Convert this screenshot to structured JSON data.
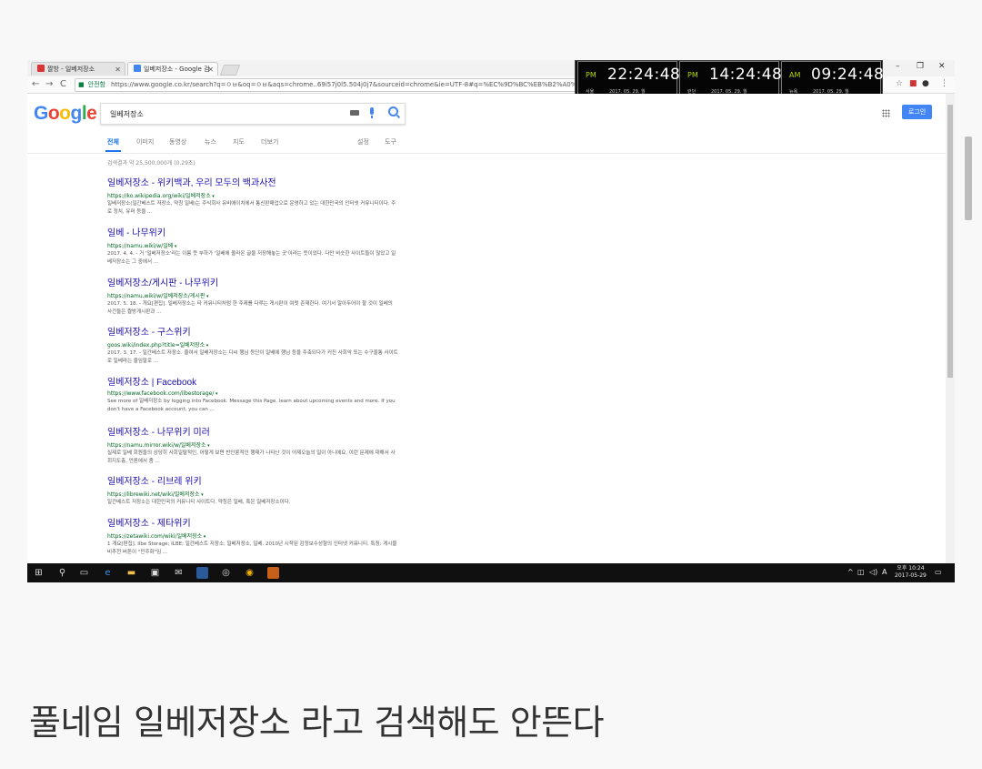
{
  "browser": {
    "tabs": [
      {
        "label": "짤방 - 일베저장소",
        "active": false,
        "favicon_color": "#d33"
      },
      {
        "label": "일베저장소 - Google 검",
        "active": true,
        "favicon_color": "#4285f4"
      }
    ],
    "window_controls": [
      "–",
      "❐",
      "✕"
    ],
    "nav": {
      "back": "←",
      "forward": "→",
      "reload": "C"
    },
    "address": {
      "secure_label": "안전함",
      "url": "https://www.google.co.kr/search?q=ㅇㅂ&oq=ㅇㅂ&aqs=chrome..69i57j0l5.504j0j7&sourceid=chrome&ie=UTF-8#q=%EC%9D%BC%EB%B2%A0%EC%A0%80%EC%9E%A5%EC%86%8C"
    }
  },
  "clocks": [
    {
      "ampm": "PM",
      "time": "22:24:48",
      "city": "서울",
      "date": "2017. 05. 29. 월"
    },
    {
      "ampm": "PM",
      "time": "14:24:48",
      "city": "런던",
      "date": "2017. 05. 29. 월"
    },
    {
      "ampm": "AM",
      "time": "09:24:48",
      "city": "뉴욕",
      "date": "2017. 05. 29. 월"
    }
  ],
  "google": {
    "logo_letters": [
      "G",
      "o",
      "o",
      "g",
      "l",
      "e"
    ],
    "query": "일베저장소",
    "login_label": "로그인",
    "tabs": [
      "전체",
      "이미지",
      "동영상",
      "뉴스",
      "지도",
      "더보기"
    ],
    "right_tabs": [
      "설정",
      "도구"
    ],
    "stats": "검색결과 약 25,500,000개 (0.29초)",
    "results": [
      {
        "title": "일베저장소 - 위키백과, 우리 모두의 백과사전",
        "url": "https://ko.wikipedia.org/wiki/일베저장소",
        "snippet": "일베저장소(일간베스트 저장소, 약칭 일베)는 주식회사 유비에이치에서 통신판매업으로 운영하고 있는 대한민국의 인터넷 커뮤니티이다. 주로 정치, 유머 등을 ..."
      },
      {
        "title": "일베 - 나무위키",
        "url": "https://namu.wiki/w/일베",
        "snippet": "2017. 4. 4. - 거 '일베저장소'라는 이름 뜻 부하가 '일베에 올라온 글을 저장해놓는 곳'이라는 뜻이었다. 다만 비슷한 사이트들이 많았고 일베저장소는 그 중에서 ..."
      },
      {
        "title": "일베저장소/게시판 - 나무위키",
        "url": "https://namu.wiki/w/일베저장소/게시판",
        "snippet": "2017. 5. 18. - 개요[편집]. 일베저장소는 타 커뮤니티처럼 한 주제를 다루는 게시판이 여럿 존재한다. 여기서 알아두어야 할 것이 일베의 사건들은 짤방게시판과 ..."
      },
      {
        "title": "일베저장소 - 구스위키",
        "url": "goos.wiki/index.php?title=일베저장소",
        "snippet": "2017. 3. 17. - 일간베스트 저장소. 줄여서 일베저장소는 디씨 행님 등단이 일베에 행님 등을 주축되다가 커진 사회악 또는 수구꼴통 사이트로 일베라는 줄임말로 ..."
      },
      {
        "title": "일베저장소 | Facebook",
        "url": "https://www.facebook.com/ilbestorage/",
        "snippet": "See more of 일베저장소 by logging into Facebook. Message this Page, learn about upcoming events and more. If you don't have a Facebook account, you can ..."
      },
      {
        "title": "일베저장소 - 나무위키 미러",
        "url": "https://namu.mirror.wiki/w/일베저장소",
        "snippet": "실제로 일베 회원들의 상당히 사회일탈적인, 어떻게 보면 반인륜적인 행태가 나타난 것이 어제오늘의 일이 아니에요. 이런 문제에 대해서 사회지도층, 언론에서 좀 ..."
      },
      {
        "title": "일베저장소 - 리브레 위키",
        "url": "https://librewiki.net/wiki/일베저장소",
        "snippet": "일간베스트 저장소는 대한민국의 커뮤니티 사이트다. 약칭은 일베, 혹은 일베저장소이다."
      },
      {
        "title": "일베저장소 - 제타위키",
        "url": "https://zetawiki.com/wiki/일베저장소",
        "snippet": "1 개요[편집]. Ilbe Storage; ILBE; 일간베스트 저장소; 일베저장소, 일베. 2010년 시작된 감정보수성향의 인터넷 커뮤니티. 특징: 게시물 비추천 버튼이 \"민주화\"임 ..."
      }
    ]
  },
  "taskbar": {
    "tray_ime": "A",
    "time": "오후 10:24",
    "date": "2017-05-29"
  },
  "caption": "풀네임 일베저장소 라고 검색해도 안뜬다"
}
